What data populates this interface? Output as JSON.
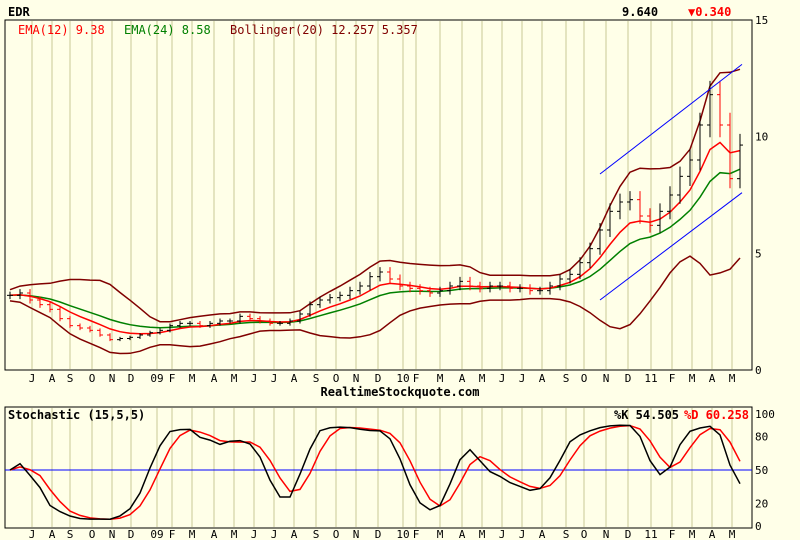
{
  "header": {
    "symbol": "EDR",
    "last_price": "9.640",
    "change": "▼0.340",
    "change_color": "#ff0000"
  },
  "legend": {
    "ema12": "EMA(12) 9.38",
    "ema24": "EMA(24) 8.58",
    "bollinger": "Bollinger(20) 12.257 5.357",
    "colors": {
      "ema12": "#ff0000",
      "ema24": "#008000",
      "bollinger": "#800000",
      "channel": "#0000ff"
    }
  },
  "footer": {
    "source": "RealtimeStockquote.com"
  },
  "stochastic": {
    "title": "Stochastic (15,5,5)",
    "k_label": "%K 54.505",
    "d_label": "%D 60.258"
  },
  "chart_data": [
    {
      "type": "line",
      "title": "EDR",
      "x_tick_labels": [
        "J",
        "A",
        "S",
        "O",
        "N",
        "D",
        "09",
        "F",
        "M",
        "A",
        "M",
        "J",
        "J",
        "A",
        "S",
        "O",
        "N",
        "D",
        "10",
        "F",
        "M",
        "A",
        "M",
        "J",
        "J",
        "A",
        "S",
        "O",
        "N",
        "D",
        "11",
        "F",
        "M",
        "A",
        "M"
      ],
      "y_tick_labels": [
        "15",
        "10",
        "5",
        "0"
      ],
      "ylim": [
        0,
        15
      ],
      "grid": true,
      "close": [
        3.2,
        3.3,
        3.0,
        2.8,
        2.6,
        2.2,
        1.9,
        1.8,
        1.7,
        1.5,
        1.3,
        1.35,
        1.4,
        1.5,
        1.6,
        1.7,
        1.9,
        2.0,
        2.0,
        1.9,
        2.0,
        2.1,
        2.1,
        2.3,
        2.2,
        2.1,
        2.0,
        2.0,
        2.1,
        2.4,
        2.8,
        3.0,
        3.1,
        3.2,
        3.4,
        3.6,
        4.0,
        4.2,
        3.9,
        3.6,
        3.5,
        3.4,
        3.3,
        3.4,
        3.6,
        3.8,
        3.6,
        3.5,
        3.6,
        3.6,
        3.5,
        3.5,
        3.4,
        3.4,
        3.6,
        3.9,
        4.1,
        4.6,
        5.2,
        6.0,
        6.8,
        7.2,
        7.3,
        6.6,
        6.2,
        6.8,
        7.5,
        8.3,
        9.0,
        10.5,
        11.8,
        10.5,
        8.2,
        9.64
      ],
      "trendlines": [
        {
          "name": "channel-upper",
          "from_index": 59,
          "to_index": 73,
          "from": 8.4,
          "to": 13.1
        },
        {
          "name": "channel-lower",
          "from_index": 59,
          "to_index": 73,
          "from": 3.0,
          "to": 7.6
        }
      ]
    },
    {
      "type": "line",
      "title": "Stochastic (15,5,5)",
      "y_tick_labels": [
        "100",
        "80",
        "50",
        "20",
        "0"
      ],
      "ylim": [
        0,
        100
      ],
      "reference_line": 50
    }
  ]
}
